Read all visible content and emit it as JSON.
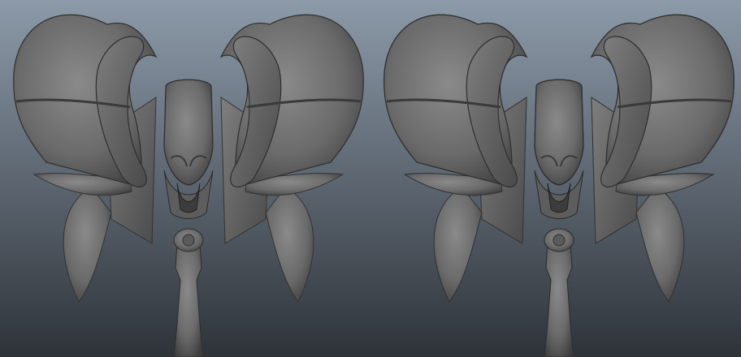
{
  "viewport": {
    "background_top": "#8c9aa9",
    "background_bottom": "#2e3339"
  },
  "panels": [
    {
      "name": "shaded-render",
      "wireframe": false
    },
    {
      "name": "wireframe-on-shaded-render",
      "wireframe": true
    }
  ],
  "model": {
    "shade_light": "#8a8a8a",
    "shade_mid": "#6a6a6a",
    "shade_dark": "#3e3e3e",
    "wire_color": "#1a1aa8"
  }
}
